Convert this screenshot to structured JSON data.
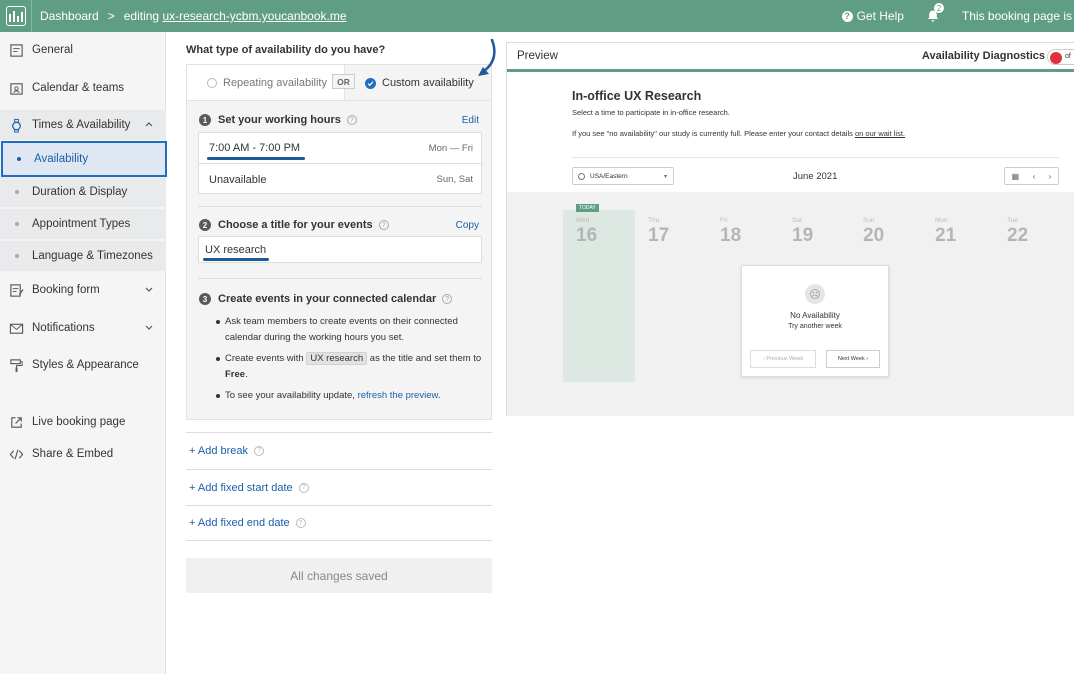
{
  "topbar": {
    "dashboard": "Dashboard",
    "separator": ">",
    "editing_prefix": "editing",
    "url": "ux-research-ycbm.youcanbook.me",
    "help": "Get Help",
    "notification_count": "2",
    "booking_status": "This booking page is"
  },
  "sidebar": {
    "general": "General",
    "calendar_teams": "Calendar & teams",
    "times_availability": "Times & Availability",
    "sub": {
      "availability": "Availability",
      "duration_display": "Duration & Display",
      "appointment_types": "Appointment Types",
      "language_timezones": "Language & Timezones"
    },
    "booking_form": "Booking form",
    "notifications": "Notifications",
    "styles_appearance": "Styles & Appearance",
    "live_booking_page": "Live booking page",
    "share_embed": "Share & Embed"
  },
  "availability": {
    "question": "What type of availability do you have?",
    "repeating": "Repeating availability",
    "or": "OR",
    "custom": "Custom availability",
    "step1": {
      "num": "1",
      "title": "Set your working hours",
      "action": "Edit"
    },
    "hours": [
      {
        "time": "7:00 AM - 7:00 PM",
        "days": "Mon — Fri"
      },
      {
        "time": "Unavailable",
        "days": "Sun, Sat"
      }
    ],
    "step2": {
      "num": "2",
      "title": "Choose a title for your events",
      "action": "Copy"
    },
    "event_title": "UX research",
    "step3": {
      "num": "3",
      "title": "Create events in your connected calendar"
    },
    "bullet1": "Ask team members to create events on their connected calendar during the working hours you set.",
    "bullet2_a": "Create events with",
    "bullet2_code": "UX research",
    "bullet2_b": "as the title and set them to",
    "bullet2_free": "Free",
    "bullet2_end": ".",
    "bullet3_a": "To see your availability update,",
    "bullet3_link": "refresh the preview",
    "bullet3_end": ".",
    "add_break": "+ Add break",
    "add_start": "+ Add fixed start date",
    "add_end": "+ Add fixed end date",
    "saved": "All changes saved"
  },
  "preview": {
    "title": "Preview",
    "diagnostics": "Availability Diagnostics",
    "toggle_text": "of",
    "booking_title": "In-office UX Research",
    "booking_sub": "Select a time to participate in in-office research.",
    "booking_note": "If you see \"no availability\" our study is currently full. Please enter your contact details",
    "booking_note_link": "on our wait list.",
    "timezone": "USA/Eastern",
    "month": "June 2021",
    "today_badge": "TODAY",
    "days": [
      {
        "name": "Wed",
        "num": "16"
      },
      {
        "name": "Thu",
        "num": "17"
      },
      {
        "name": "Fri",
        "num": "18"
      },
      {
        "name": "Sat",
        "num": "19"
      },
      {
        "name": "Sun",
        "num": "20"
      },
      {
        "name": "Mon",
        "num": "21"
      },
      {
        "name": "Tue",
        "num": "22"
      }
    ],
    "no_availability": "No Availability",
    "try_another": "Try another week",
    "prev_week": "Previous Week",
    "next_week": "Next Week"
  },
  "colors": {
    "brand": "#5f9e85",
    "accent": "#1e6fc0",
    "toggle_red": "#e0303f"
  }
}
